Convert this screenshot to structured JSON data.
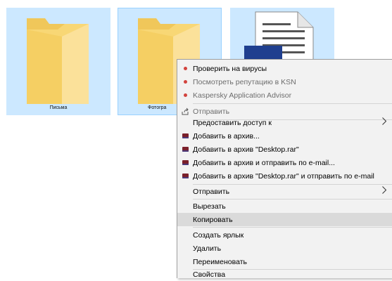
{
  "desktop": {
    "items": [
      {
        "caption": "Письма"
      },
      {
        "caption": "Фотогра"
      },
      {
        "caption": ""
      }
    ]
  },
  "context_menu": {
    "items": [
      {
        "label": "Проверить на вирусы",
        "icon": "kaspersky-icon",
        "disabled": false
      },
      {
        "label": "Посмотреть репутацию в KSN",
        "icon": "kaspersky-icon",
        "disabled": true
      },
      {
        "label": "Kaspersky Application Advisor",
        "icon": "kaspersky-icon",
        "disabled": true
      },
      {
        "label": "Отправить",
        "icon": "share-icon",
        "disabled": true
      },
      {
        "label": "Предоставить доступ к",
        "submenu": true
      },
      {
        "label": "Добавить в архив...",
        "icon": "winrar-icon"
      },
      {
        "label": "Добавить в архив \"Desktop.rar\"",
        "icon": "winrar-icon"
      },
      {
        "label": "Добавить в архив и отправить по e-mail...",
        "icon": "winrar-icon"
      },
      {
        "label": "Добавить в архив \"Desktop.rar\" и отправить по e-mail",
        "icon": "winrar-icon"
      },
      {
        "label": "Отправить",
        "submenu": true
      },
      {
        "label": "Вырезать"
      },
      {
        "label": "Копировать",
        "highlighted": true
      },
      {
        "label": "Создать ярлык"
      },
      {
        "label": "Удалить"
      },
      {
        "label": "Переименовать"
      },
      {
        "label": "Свойства"
      }
    ],
    "submenu_arrow": "›"
  },
  "colors": {
    "selection": "#cce8ff",
    "menu_bg": "#f2f2f2",
    "menu_highlight": "#dadada",
    "folder_yellow": "#f8d775",
    "doc_blue": "#1f3f8f"
  }
}
